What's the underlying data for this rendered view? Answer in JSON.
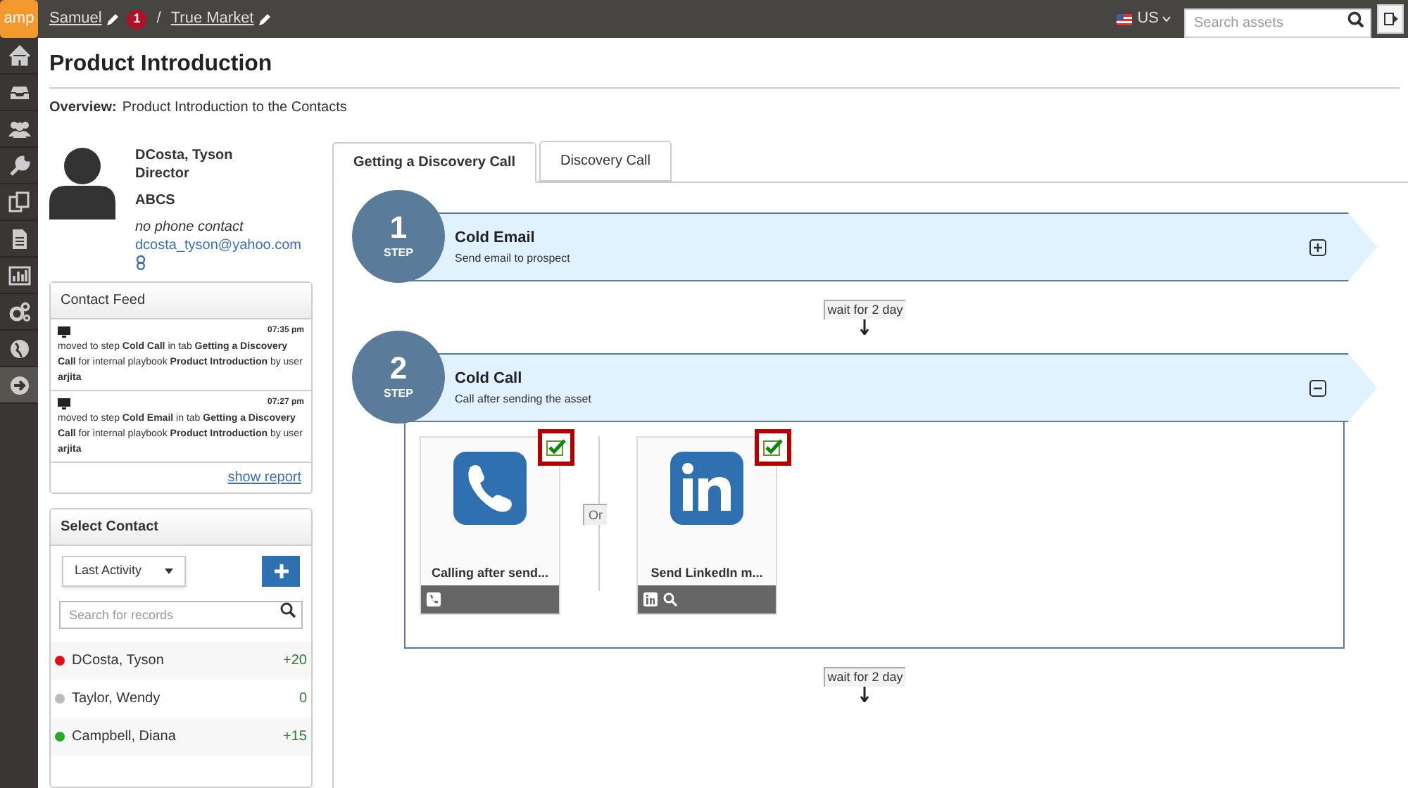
{
  "topbar": {
    "logo": "amp",
    "breadcrumb": [
      {
        "text": "Samuel",
        "badge": "1"
      },
      {
        "text": "True Market"
      }
    ],
    "separator": "/",
    "locale": "US",
    "search": {
      "placeholder": "Search assets"
    }
  },
  "nav": [
    {
      "selected": false
    },
    {
      "selected": false
    },
    {
      "selected": false
    },
    {
      "selected": false
    },
    {
      "selected": false
    },
    {
      "selected": false
    },
    {
      "selected": false
    },
    {
      "selected": false
    },
    {
      "selected": false
    },
    {
      "selected": true
    }
  ],
  "page": {
    "title": "Product Introduction",
    "overview_label": "Overview:",
    "overview": "Product Introduction to the Contacts"
  },
  "contact": {
    "name": "DCosta, Tyson",
    "role": "Director",
    "company": "ABCS",
    "phone": "no phone contact",
    "email": "dcosta_tyson@yahoo.com"
  },
  "contact_feed": {
    "title": "Contact Feed",
    "items": [
      {
        "time": "07:35 pm",
        "text": "moved to step **Cold Call** in tab **Getting a Discovery Call** for internal playbook **Product Introduction** by user **arjita**"
      },
      {
        "time": "07:27 pm",
        "text": "moved to step **Cold Email** in tab **Getting a Discovery Call** for internal playbook **Product Introduction** by user **arjita**"
      }
    ],
    "link": "show report"
  },
  "select_contact": {
    "title": "Select Contact",
    "sort": "Last Activity",
    "search": {
      "placeholder": "Search for records"
    },
    "contacts": [
      {
        "name": "DCosta, Tyson",
        "score": "+20",
        "color": "#e01010"
      },
      {
        "name": "Taylor, Wendy",
        "score": "0",
        "color": "#bbbbbb"
      },
      {
        "name": "Campbell, Diana",
        "score": "+15",
        "color": "#22aa22"
      }
    ]
  },
  "tabs": [
    {
      "label": "Getting a Discovery Call",
      "selected": true
    },
    {
      "label": "Discovery Call",
      "selected": false
    }
  ],
  "flow": [
    {
      "kind": "step",
      "number": "1",
      "label": "STEP",
      "title": "Cold Email",
      "subtitle": "Send email to prospect",
      "expanded": false
    },
    {
      "kind": "wait",
      "text": "wait for 2 day"
    },
    {
      "kind": "step",
      "number": "2",
      "label": "STEP",
      "title": "Cold Call",
      "subtitle": "Call after sending the asset",
      "expanded": true,
      "connector": "Or",
      "actions": [
        {
          "kind": "phone",
          "title": "Calling after send...",
          "checked": true,
          "tools": [
            {
              "kind": "phone"
            }
          ]
        },
        {
          "kind": "linkedin",
          "title": "Send LinkedIn m...",
          "checked": true,
          "tools": [
            {
              "kind": "linkedin"
            },
            {
              "kind": "search"
            }
          ]
        }
      ]
    },
    {
      "kind": "wait",
      "text": "wait for 2 day"
    }
  ]
}
